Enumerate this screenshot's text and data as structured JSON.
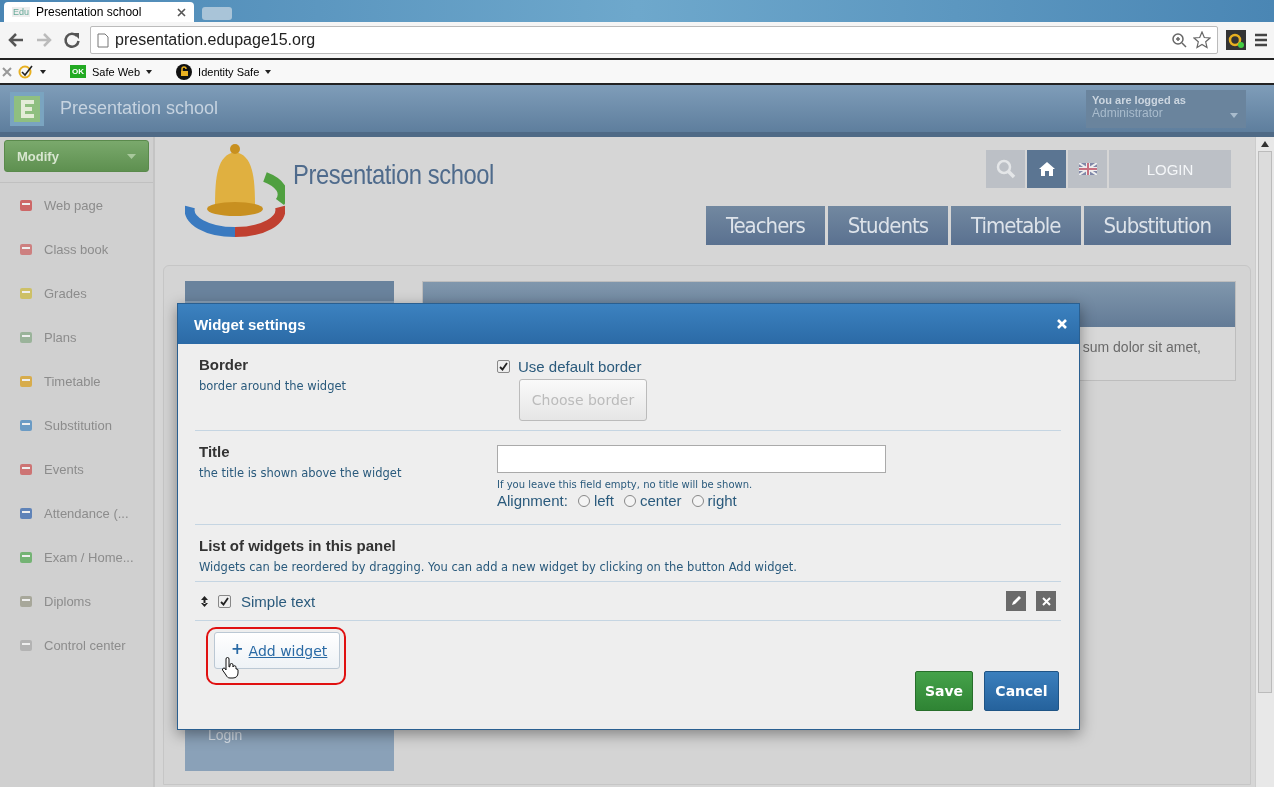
{
  "browser": {
    "tab_title": "Presentation school",
    "favicon": "Edu",
    "url": "presentation.edupage15.org",
    "bookmarks": [
      "Safe Web",
      "Identity Safe"
    ],
    "ok_badge": "OK"
  },
  "header": {
    "title": "Presentation school",
    "logged_label": "You are logged as",
    "user": "Administrator"
  },
  "sidebar": {
    "modify": "Modify",
    "items": [
      {
        "label": "Web page"
      },
      {
        "label": "Class book"
      },
      {
        "label": "Grades"
      },
      {
        "label": "Plans"
      },
      {
        "label": "Timetable"
      },
      {
        "label": "Substitution"
      },
      {
        "label": "Events"
      },
      {
        "label": "Attendance (..."
      },
      {
        "label": "Exam / Home..."
      },
      {
        "label": "Diploms"
      },
      {
        "label": "Control center"
      }
    ]
  },
  "site": {
    "title": "Presentation school",
    "login": "LOGIN",
    "nav": [
      "Teachers",
      "Students",
      "Timetable",
      "Substitution"
    ]
  },
  "panels": {
    "nav_items": [
      "Login"
    ],
    "content_text": "sum dolor sit amet,"
  },
  "dialog": {
    "title": "Widget settings",
    "border": {
      "label": "Border",
      "hint": "border around the widget",
      "checkbox": {
        "label": "Use default border",
        "checked": true
      },
      "button": {
        "label": "Choose border",
        "disabled": true
      }
    },
    "title_section": {
      "label": "Title",
      "hint": "the title is shown above the widget",
      "note": "If you leave this field empty, no title will be shown.",
      "alignment_label": "Alignment:",
      "options": [
        {
          "label": "left",
          "selected": false
        },
        {
          "label": "center",
          "selected": false
        },
        {
          "label": "right",
          "selected": false
        }
      ]
    },
    "list": {
      "heading": "List of widgets in this panel",
      "hint": "Widgets can be reordered by dragging. You can add a new widget by clicking on the button Add widget.",
      "widgets": [
        {
          "name": "Simple text",
          "checked": true
        }
      ]
    },
    "add": {
      "icon": "+",
      "label": "Add widget"
    },
    "buttons": {
      "save": "Save",
      "cancel": "Cancel"
    }
  }
}
